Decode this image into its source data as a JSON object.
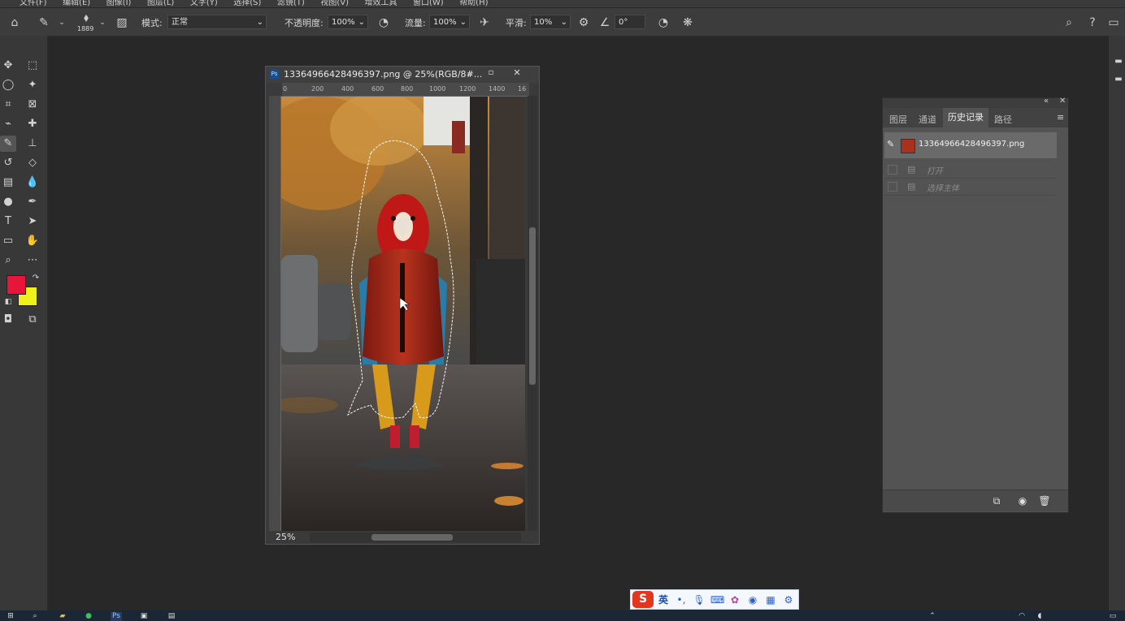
{
  "menu": {
    "items": [
      "文件(F)",
      "编辑(E)",
      "图像(I)",
      "图层(L)",
      "文字(Y)",
      "选择(S)",
      "滤镜(T)",
      "视图(V)",
      "增效工具",
      "窗口(W)",
      "帮助(H)"
    ]
  },
  "options": {
    "brush_size": "1889",
    "mode_label": "模式:",
    "mode_value": "正常",
    "opacity_label": "不透明度:",
    "opacity_value": "100%",
    "flow_label": "流量:",
    "flow_value": "100%",
    "smoothing_label": "平滑:",
    "smoothing_value": "10%",
    "angle_value": "0°"
  },
  "colors": {
    "foreground": "#e8153a",
    "background": "#eef21a"
  },
  "document": {
    "title": "13364966428496397.png @ 25%(RGB/8#...",
    "zoom": "25%",
    "ruler_ticks": [
      "0",
      "200",
      "400",
      "600",
      "800",
      "1000",
      "1200",
      "1400",
      "16"
    ]
  },
  "history_panel": {
    "tabs": [
      "图层",
      "通道",
      "历史记录",
      "路径"
    ],
    "active_tab": "历史记录",
    "snapshot_name": "13364966428496397.png",
    "states": [
      "打开",
      "选择主体"
    ]
  },
  "ime": {
    "lang": "英"
  }
}
